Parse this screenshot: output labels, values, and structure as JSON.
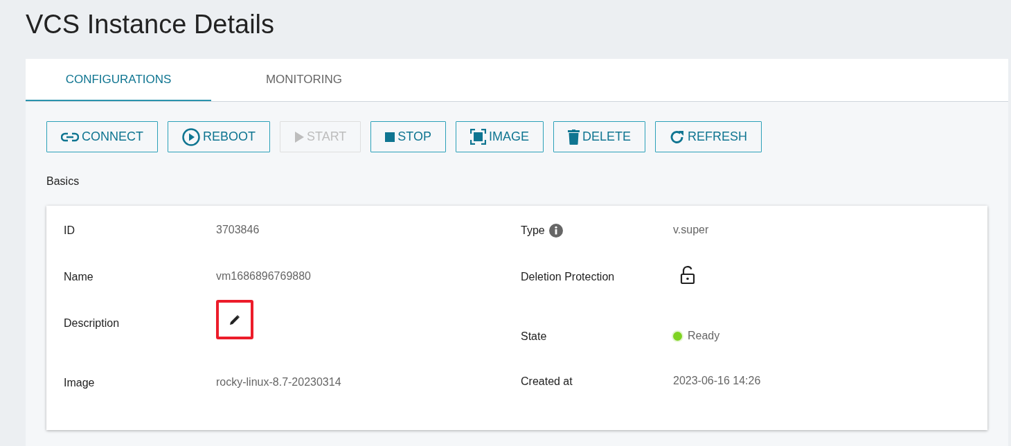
{
  "page": {
    "title": "VCS Instance Details"
  },
  "tabs": [
    {
      "label": "CONFIGURATIONS",
      "selected": true
    },
    {
      "label": "MONITORING",
      "selected": false
    }
  ],
  "toolbar": [
    {
      "label": "CONNECT",
      "kind": "link",
      "disabled": false
    },
    {
      "label": "REBOOT",
      "kind": "reboot",
      "disabled": false
    },
    {
      "label": "START",
      "kind": "start",
      "disabled": true
    },
    {
      "label": "STOP",
      "kind": "stop",
      "disabled": false
    },
    {
      "label": "IMAGE",
      "kind": "image",
      "disabled": false
    },
    {
      "label": "DELETE",
      "kind": "delete",
      "disabled": false
    },
    {
      "label": "REFRESH",
      "kind": "refresh",
      "disabled": false
    }
  ],
  "section": {
    "title": "Basics"
  },
  "details": {
    "left": [
      {
        "kind": "text",
        "label": "ID",
        "value": "3703846"
      },
      {
        "kind": "text",
        "label": "Name",
        "value": "vm1686896769880"
      },
      {
        "kind": "edit",
        "label": "Description",
        "highlighted": true
      },
      {
        "kind": "text",
        "label": "Image",
        "value": "rocky-linux-8.7-20230314"
      }
    ],
    "right": [
      {
        "kind": "info",
        "label": "Type",
        "value": "v.super"
      },
      {
        "kind": "lock",
        "label": "Deletion Protection",
        "locked": false
      },
      {
        "kind": "status",
        "label": "State",
        "value": "Ready",
        "color": "#7ed321"
      },
      {
        "kind": "text",
        "label": "Created at",
        "value": "2023-06-16 14:26"
      }
    ]
  }
}
